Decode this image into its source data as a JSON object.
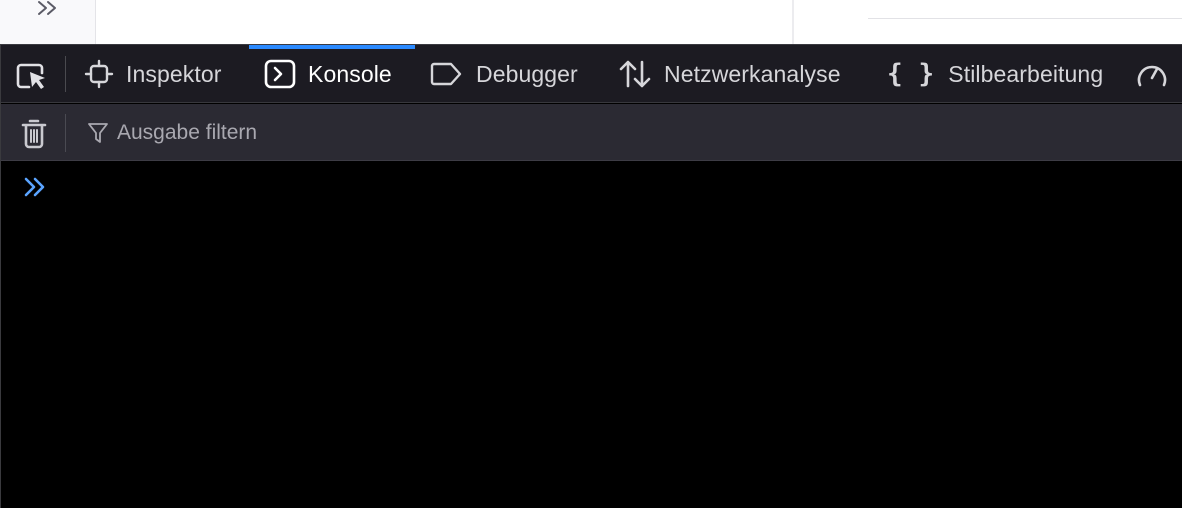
{
  "devtools": {
    "tabs": [
      {
        "label": "Inspektor",
        "icon": "inspector-icon",
        "active": false
      },
      {
        "label": "Konsole",
        "icon": "console-icon",
        "active": true
      },
      {
        "label": "Debugger",
        "icon": "debugger-icon",
        "active": false
      },
      {
        "label": "Netzwerkanalyse",
        "icon": "network-icon",
        "active": false
      },
      {
        "label": "Stilbearbeitung",
        "icon": "style-editor-icon",
        "active": false
      }
    ],
    "toolbar": {
      "filter_placeholder": "Ausgabe filtern"
    },
    "colors": {
      "accent": "#2a8aff",
      "prompt": "#5aa4ff",
      "tabbar_bg": "#1c1b22",
      "toolbar_bg": "#2b2a33",
      "console_bg": "#000000"
    }
  }
}
